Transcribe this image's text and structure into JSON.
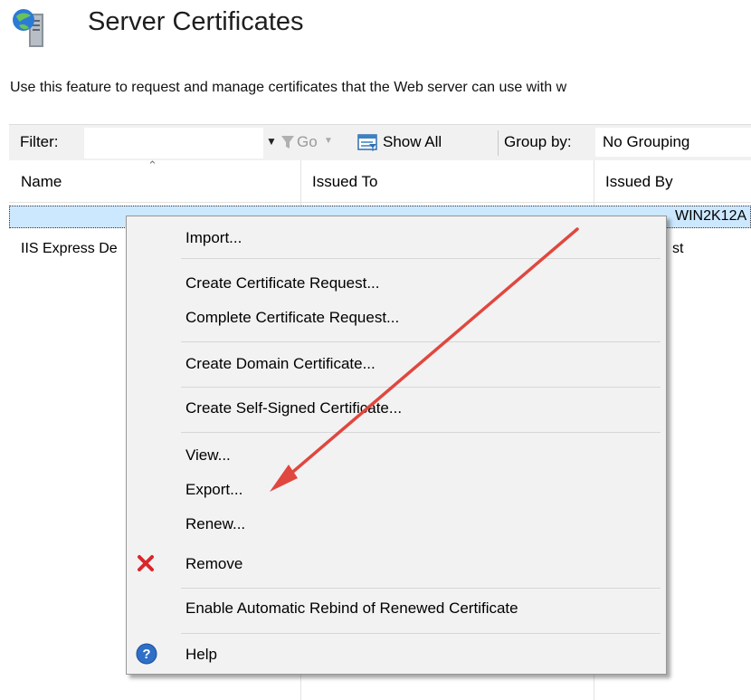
{
  "header": {
    "title": "Server Certificates",
    "icon": "server-icon",
    "description": "Use this feature to request and manage certificates that the Web server can use with w"
  },
  "toolbar": {
    "filter_label": "Filter:",
    "filter_value": "",
    "go_label": "Go",
    "show_all_label": "Show All",
    "group_by_label": "Group by:",
    "group_by_value": "No Grouping"
  },
  "grid": {
    "columns": [
      "Name",
      "Issued To",
      "Issued By"
    ],
    "rows": [
      {
        "name": "",
        "issued_to": "",
        "issued_by": "WIN2K12A"
      },
      {
        "name": "IIS Express De",
        "issued_to": "",
        "issued_by": "st"
      }
    ]
  },
  "context_menu": {
    "items": [
      {
        "label": "Import...",
        "icon": ""
      },
      {
        "label": "Create Certificate Request...",
        "icon": ""
      },
      {
        "label": "Complete Certificate Request...",
        "icon": ""
      },
      {
        "label": "Create Domain Certificate...",
        "icon": ""
      },
      {
        "label": "Create Self-Signed Certificate...",
        "icon": ""
      },
      {
        "label": "View...",
        "icon": ""
      },
      {
        "label": "Export...",
        "icon": ""
      },
      {
        "label": "Renew...",
        "icon": ""
      },
      {
        "label": "Remove",
        "icon": "remove-icon"
      },
      {
        "label": "Enable Automatic Rebind of Renewed Certificate",
        "icon": ""
      },
      {
        "label": "Help",
        "icon": "help-icon"
      }
    ]
  },
  "colors": {
    "selection": "#cce8ff",
    "menu_background": "#f2f2f2",
    "annotation_arrow": "#e0473f",
    "remove_icon": "#d9262b",
    "help_icon": "#2f6fc8"
  }
}
